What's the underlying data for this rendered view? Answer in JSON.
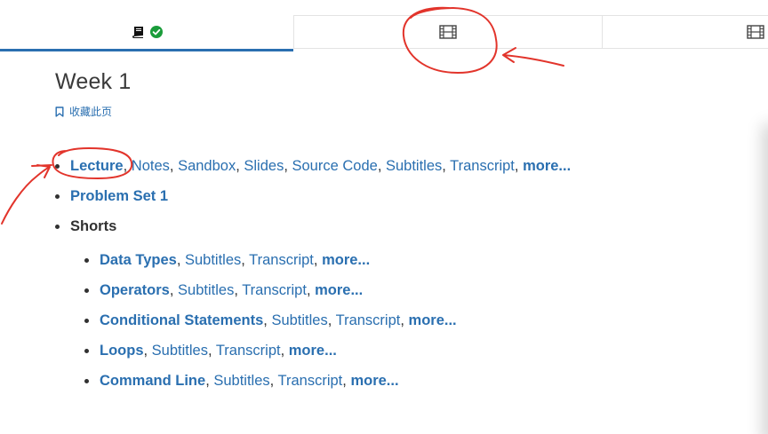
{
  "tabs": [
    {
      "name": "notes-tab",
      "icons": [
        "book-icon",
        "check-circle-icon"
      ],
      "selected": true
    },
    {
      "name": "video-tab",
      "icons": [
        "film-icon"
      ],
      "selected": false
    },
    {
      "name": "video-tab-2",
      "icons": [
        "film-icon"
      ],
      "selected": false
    }
  ],
  "page": {
    "title": "Week 1",
    "bookmark_label": "收藏此页"
  },
  "colors": {
    "link": "#2a6fb0",
    "text": "#313131",
    "annotation": "#e2342b",
    "check": "#1a9c3a"
  },
  "items": {
    "lecture": {
      "primary": "Lecture",
      "links": [
        "Notes",
        "Sandbox",
        "Slides",
        "Source Code",
        "Subtitles",
        "Transcript"
      ],
      "more": "more..."
    },
    "problem_set": {
      "label": "Problem Set 1"
    },
    "shorts": {
      "label": "Shorts",
      "items": [
        {
          "primary": "Data Types",
          "links": [
            "Subtitles",
            "Transcript"
          ],
          "more": "more..."
        },
        {
          "primary": "Operators",
          "links": [
            "Subtitles",
            "Transcript"
          ],
          "more": "more..."
        },
        {
          "primary": "Conditional Statements",
          "links": [
            "Subtitles",
            "Transcript"
          ],
          "more": "more..."
        },
        {
          "primary": "Loops",
          "links": [
            "Subtitles",
            "Transcript"
          ],
          "more": "more..."
        },
        {
          "primary": "Command Line",
          "links": [
            "Subtitles",
            "Transcript"
          ],
          "more": "more..."
        }
      ]
    }
  }
}
